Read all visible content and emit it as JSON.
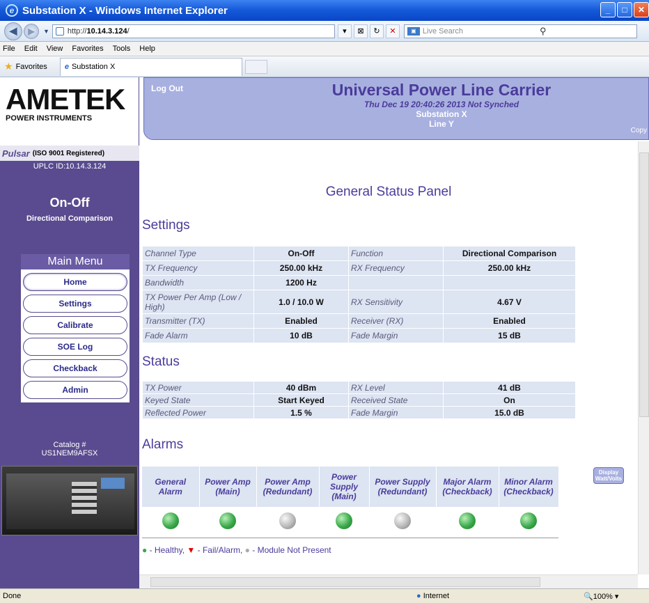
{
  "window": {
    "title": "Substation X - Windows Internet Explorer"
  },
  "address": {
    "url_prefix": "http://",
    "url_host": "10.14.3.124",
    "url_suffix": "/",
    "search_placeholder": "Live Search"
  },
  "menubar": {
    "items": [
      "File",
      "Edit",
      "View",
      "Favorites",
      "Tools",
      "Help"
    ]
  },
  "favorites": {
    "label": "Favorites",
    "tab_title": "Substation X"
  },
  "header": {
    "logout": "Log Out",
    "title": "Universal Power Line Carrier",
    "datetime": "Thu Dec 19 20:40:26 2013 Not Synched",
    "substation": "Substation X",
    "line": "Line Y",
    "copy": "Copy"
  },
  "sidebar": {
    "brand": "AMETEK",
    "brand_sub": "POWER INSTRUMENTS",
    "pulsar": "Pulsar",
    "iso": "(ISO 9001 Registered)",
    "uplc_id": "UPLC ID:10.14.3.124",
    "mode": "On-Off",
    "mode_sub": "Directional Comparison",
    "menu_title": "Main Menu",
    "menu": [
      "Home",
      "Settings",
      "Calibrate",
      "SOE Log",
      "Checkback",
      "Admin"
    ],
    "catalog_label": "Catalog #",
    "catalog_value": "US1NEM9AFSX"
  },
  "panel": {
    "title": "General Status Panel"
  },
  "settings": {
    "title": "Settings",
    "rows": [
      [
        "Channel Type",
        "On-Off",
        "Function",
        "Directional Comparison"
      ],
      [
        "TX Frequency",
        "250.00  kHz",
        "RX Frequency",
        "250.00  kHz"
      ],
      [
        "Bandwidth",
        "1200  Hz",
        "",
        ""
      ],
      [
        "TX Power Per Amp (Low / High)",
        "1.0 / 10.0  W",
        "RX Sensitivity",
        "4.67 V"
      ],
      [
        "Transmitter (TX)",
        "Enabled",
        "Receiver (RX)",
        "Enabled"
      ],
      [
        "Fade Alarm",
        "10  dB",
        "Fade Margin",
        "15  dB"
      ]
    ]
  },
  "status": {
    "title": "Status",
    "rows": [
      [
        "TX Power",
        "40 dBm",
        "RX Level",
        "41 dB"
      ],
      [
        "Keyed State",
        "Start Keyed",
        "Received State",
        "On"
      ],
      [
        "Reflected Power",
        "1.5 %",
        "Fade Margin",
        "15.0 dB"
      ]
    ],
    "display_btn": "Display Watt/Volts"
  },
  "alarms": {
    "title": "Alarms",
    "columns": [
      "General Alarm",
      "Power Amp (Main)",
      "Power Amp (Redundant)",
      "Power Supply (Main)",
      "Power Supply (Redundant)",
      "Major Alarm (Checkback)",
      "Minor Alarm (Checkback)"
    ],
    "states": [
      "green",
      "green",
      "gray",
      "green",
      "gray",
      "green",
      "green"
    ],
    "legend": [
      "- Healthy,",
      "- Fail/Alarm,",
      "- Module Not Present"
    ]
  },
  "statusbar": {
    "left": "Done",
    "zone": "Internet",
    "zoom": "100%"
  }
}
